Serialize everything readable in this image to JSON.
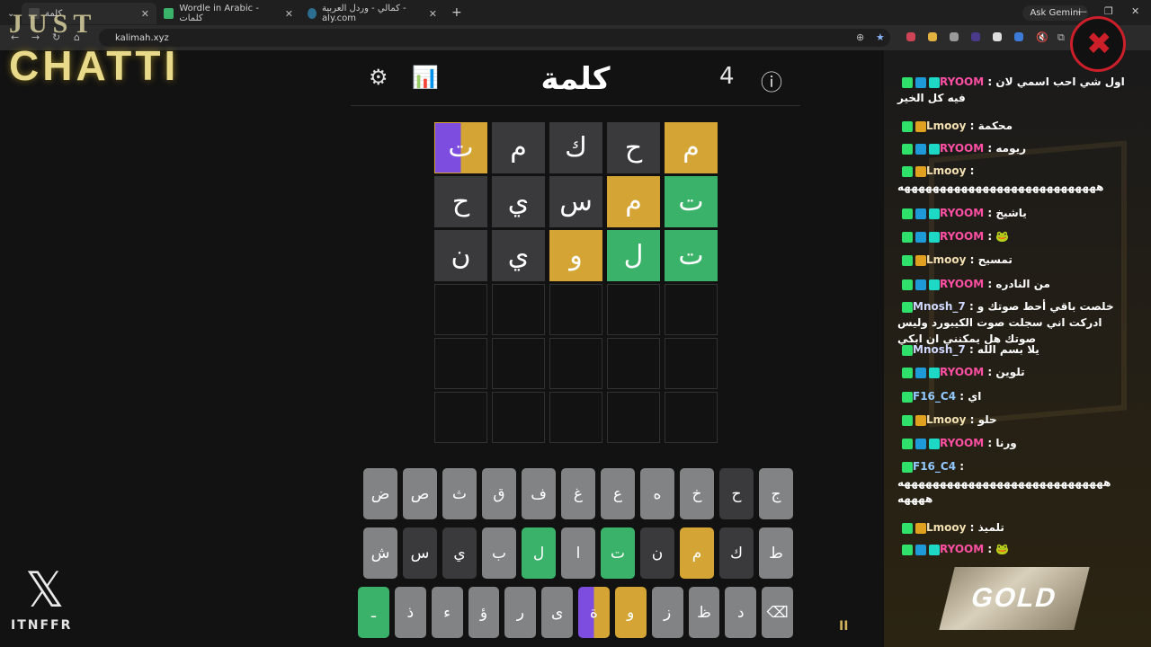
{
  "browser": {
    "tabs": [
      {
        "label": "كلمة",
        "active": true
      },
      {
        "label": "Wordle in Arabic - كلمات"
      },
      {
        "label": "كمالي - وردل العربية - aly.com"
      }
    ],
    "new_tab": "+",
    "ask_gemini": "Ask Gemini",
    "url": "kalimah.xyz"
  },
  "overlay": {
    "just": "JUST",
    "chatting": "CHATTI",
    "x_handle": "ITNFFR"
  },
  "game": {
    "title": "كلمة",
    "counter": "4",
    "grid": [
      [
        {
          "ch": "م",
          "s": "y"
        },
        {
          "ch": "ح",
          "s": "d"
        },
        {
          "ch": "ك",
          "s": "d"
        },
        {
          "ch": "م",
          "s": "d"
        },
        {
          "ch": "ت",
          "s": "p"
        }
      ],
      [
        {
          "ch": "ت",
          "s": "g"
        },
        {
          "ch": "م",
          "s": "y"
        },
        {
          "ch": "س",
          "s": "d"
        },
        {
          "ch": "ي",
          "s": "d"
        },
        {
          "ch": "ح",
          "s": "d"
        }
      ],
      [
        {
          "ch": "ت",
          "s": "g"
        },
        {
          "ch": "ل",
          "s": "g"
        },
        {
          "ch": "و",
          "s": "y"
        },
        {
          "ch": "ي",
          "s": "d"
        },
        {
          "ch": "ن",
          "s": "d"
        }
      ],
      [
        {
          "ch": "",
          "s": "e"
        },
        {
          "ch": "",
          "s": "e"
        },
        {
          "ch": "",
          "s": "e"
        },
        {
          "ch": "",
          "s": "e"
        },
        {
          "ch": "",
          "s": "e"
        }
      ],
      [
        {
          "ch": "",
          "s": "e"
        },
        {
          "ch": "",
          "s": "e"
        },
        {
          "ch": "",
          "s": "e"
        },
        {
          "ch": "",
          "s": "e"
        },
        {
          "ch": "",
          "s": "e"
        }
      ],
      [
        {
          "ch": "",
          "s": "e"
        },
        {
          "ch": "",
          "s": "e"
        },
        {
          "ch": "",
          "s": "e"
        },
        {
          "ch": "",
          "s": "e"
        },
        {
          "ch": "",
          "s": "e"
        }
      ]
    ],
    "keyboard": [
      [
        {
          "k": "ج"
        },
        {
          "k": "ح",
          "s": "d"
        },
        {
          "k": "خ"
        },
        {
          "k": "ه"
        },
        {
          "k": "ع"
        },
        {
          "k": "غ"
        },
        {
          "k": "ف"
        },
        {
          "k": "ق"
        },
        {
          "k": "ث"
        },
        {
          "k": "ص"
        },
        {
          "k": "ض"
        }
      ],
      [
        {
          "k": "ط"
        },
        {
          "k": "ك",
          "s": "d"
        },
        {
          "k": "م",
          "s": "y"
        },
        {
          "k": "ن",
          "s": "d"
        },
        {
          "k": "ت",
          "s": "g"
        },
        {
          "k": "ا"
        },
        {
          "k": "ل",
          "s": "g"
        },
        {
          "k": "ب"
        },
        {
          "k": "ي",
          "s": "d"
        },
        {
          "k": "س",
          "s": "d"
        },
        {
          "k": "ش"
        }
      ],
      [
        {
          "k": "⌫"
        },
        {
          "k": "د"
        },
        {
          "k": "ظ"
        },
        {
          "k": "ز"
        },
        {
          "k": "و",
          "s": "y"
        },
        {
          "k": "ة",
          "s": "p"
        },
        {
          "k": "ى"
        },
        {
          "k": "ر"
        },
        {
          "k": "ؤ"
        },
        {
          "k": "ء"
        },
        {
          "k": "ذ"
        },
        {
          "k": "ـ",
          "s": "g"
        }
      ]
    ]
  },
  "chat": {
    "messages": [
      {
        "user": "RYOOM",
        "text": "اول شي احب اسمي لان فيه كل الخير",
        "cls": "ry",
        "badges": [
          "k",
          "arrow",
          "gem"
        ]
      },
      {
        "user": "Lmooy",
        "text": "محكمة",
        "cls": "lm",
        "badges": [
          "k",
          "crown"
        ]
      },
      {
        "user": "RYOOM",
        "text": "ريومه",
        "cls": "ry",
        "badges": [
          "k",
          "arrow",
          "gem"
        ]
      },
      {
        "user": "Lmooy",
        "text": "ههههههههههههههههههههههههههههه",
        "cls": "lm",
        "badges": [
          "k",
          "crown"
        ]
      },
      {
        "user": "RYOOM",
        "text": "ياشيخ",
        "cls": "ry",
        "badges": [
          "k",
          "arrow",
          "gem"
        ]
      },
      {
        "user": "RYOOM",
        "text": "🐸",
        "cls": "ry",
        "badges": [
          "k",
          "arrow",
          "gem"
        ]
      },
      {
        "user": "Lmooy",
        "text": "تمسيح",
        "cls": "lm",
        "badges": [
          "k",
          "crown"
        ]
      },
      {
        "user": "RYOOM",
        "text": "من النادره",
        "cls": "ry",
        "badges": [
          "k",
          "arrow",
          "gem"
        ]
      },
      {
        "user": "Mnosh_7",
        "text": "خلصت باقي أحط صوتك و ادركت اني سجلت صوت الكيبورد وليس صوتك هل يمكنني ان ابكي",
        "cls": "mn",
        "badges": [
          "k"
        ]
      },
      {
        "user": "Mnosh_7",
        "text": "يلا بسم الله",
        "cls": "mn",
        "badges": [
          "k"
        ]
      },
      {
        "user": "RYOOM",
        "text": "تلوين",
        "cls": "ry",
        "badges": [
          "k",
          "arrow",
          "gem"
        ]
      },
      {
        "user": "F16_C4",
        "text": "اي",
        "cls": "f16",
        "badges": [
          "k"
        ]
      },
      {
        "user": "Lmooy",
        "text": "حلو",
        "cls": "lm",
        "badges": [
          "k",
          "crown"
        ]
      },
      {
        "user": "RYOOM",
        "text": "ورنا",
        "cls": "ry",
        "badges": [
          "k",
          "arrow",
          "gem"
        ]
      },
      {
        "user": "F16_C4",
        "text": "هههههههههههههههههههههههههههههه ههههه",
        "cls": "f16",
        "badges": [
          "k"
        ]
      },
      {
        "user": "Lmooy",
        "text": "تلميذ",
        "cls": "lm",
        "badges": [
          "k",
          "crown"
        ]
      },
      {
        "user": "RYOOM",
        "text": "🐸",
        "cls": "ry",
        "badges": [
          "k",
          "arrow",
          "gem"
        ]
      }
    ],
    "gold_label": "GOLD"
  },
  "status": {
    "pause": "II"
  },
  "colors": {
    "green": "#3bb26a",
    "yellow": "#d4a534",
    "dark": "#3a3a3c",
    "purple": "#7c4ddf"
  }
}
